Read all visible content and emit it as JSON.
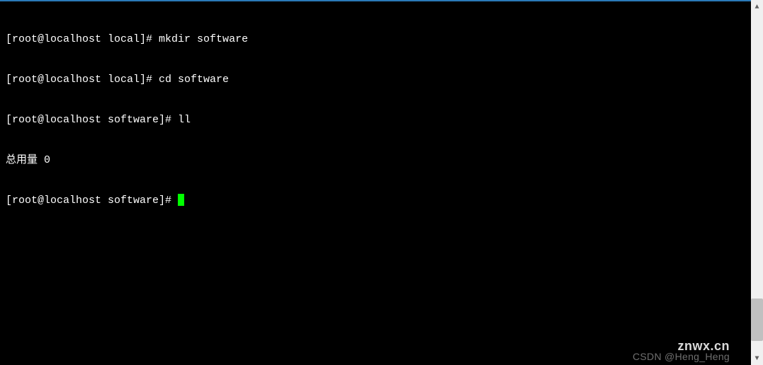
{
  "terminal": {
    "lines": [
      {
        "prompt": "[root@localhost local]# ",
        "command": "mkdir software"
      },
      {
        "prompt": "[root@localhost local]# ",
        "command": "cd software"
      },
      {
        "prompt": "[root@localhost software]# ",
        "command": "ll"
      },
      {
        "output": "总用量 0"
      },
      {
        "prompt": "[root@localhost software]# ",
        "cursor": true
      }
    ]
  },
  "scrollbar": {
    "up_glyph": "▲",
    "down_glyph": "▼"
  },
  "watermarks": {
    "primary": "znwx.cn",
    "secondary": "CSDN @Heng_Heng"
  }
}
